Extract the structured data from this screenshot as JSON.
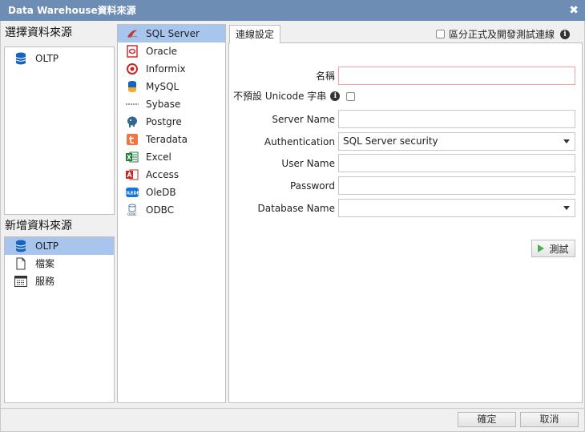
{
  "window": {
    "title": "Data Warehouse資料來源"
  },
  "left": {
    "select_title": "選擇資料來源",
    "select_items": [
      {
        "label": "OLTP",
        "icon": "database-icon"
      }
    ],
    "add_title": "新增資料來源",
    "add_items": [
      {
        "label": "OLTP",
        "icon": "database-icon",
        "selected": true
      },
      {
        "label": "檔案",
        "icon": "file-icon"
      },
      {
        "label": "服務",
        "icon": "service-icon"
      }
    ]
  },
  "providers": [
    {
      "label": "SQL Server",
      "icon": "sqlserver-icon",
      "selected": true,
      "color": "#c0392b"
    },
    {
      "label": "Oracle",
      "icon": "oracle-icon",
      "color": "#d32f2f"
    },
    {
      "label": "Informix",
      "icon": "informix-icon",
      "color": "#c62828"
    },
    {
      "label": "MySQL",
      "icon": "mysql-icon",
      "color": "#1565c0"
    },
    {
      "label": "Sybase",
      "icon": "sybase-icon",
      "color": "#666666"
    },
    {
      "label": "Postgre",
      "icon": "postgre-icon",
      "color": "#336791"
    },
    {
      "label": "Teradata",
      "icon": "teradata-icon",
      "color": "#f37440"
    },
    {
      "label": "Excel",
      "icon": "excel-icon",
      "color": "#1e7e34"
    },
    {
      "label": "Access",
      "icon": "access-icon",
      "color": "#c62828"
    },
    {
      "label": "OleDB",
      "icon": "oledb-icon",
      "color": "#1976d2"
    },
    {
      "label": "ODBC",
      "icon": "odbc-icon",
      "color": "#5a7fa8"
    }
  ],
  "connection": {
    "tab_label": "連線設定",
    "separate_label": "區分正式及開發測試連線",
    "name_label": "名稱",
    "name_value": "",
    "no_unicode_label": "不預設 Unicode 字串",
    "server_name_label": "Server Name",
    "server_name_value": "",
    "auth_label": "Authentication",
    "auth_value": "SQL Server security",
    "user_name_label": "User Name",
    "user_name_value": "",
    "password_label": "Password",
    "password_value": "",
    "db_name_label": "Database Name",
    "db_name_value": "",
    "test_label": "測試"
  },
  "footer": {
    "ok_label": "確定",
    "cancel_label": "取消"
  }
}
